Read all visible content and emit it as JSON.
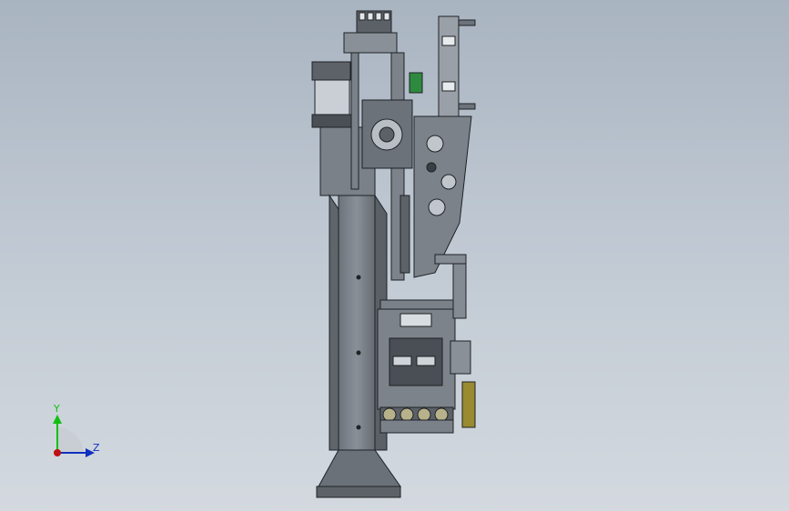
{
  "viewport": {
    "background_top": "#a9b4c1",
    "background_bottom": "#d3d9df"
  },
  "triad": {
    "y_label": "Y",
    "z_label": "Z",
    "y_color": "#10c010",
    "z_color": "#1030c0",
    "x_origin_color": "#c01010"
  }
}
